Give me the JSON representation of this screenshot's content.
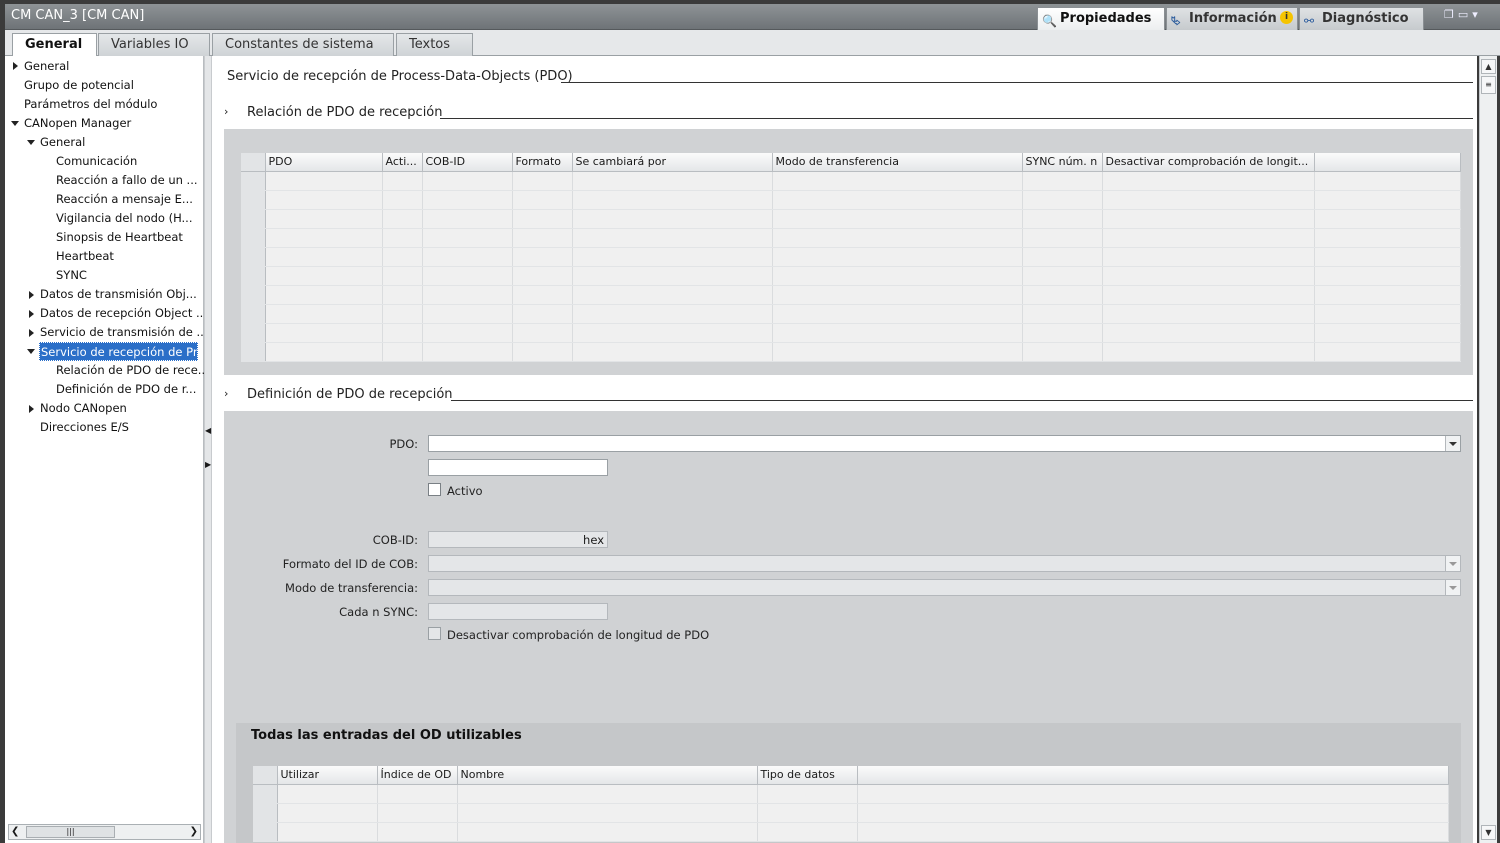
{
  "window": {
    "title": "CM CAN_3 [CM CAN]"
  },
  "panel_tabs": [
    {
      "label": "Propiedades",
      "icon": "properties-icon"
    },
    {
      "label": "Información",
      "icon": "info-icon"
    },
    {
      "label": "Diagnóstico",
      "icon": "diagnostics-icon"
    }
  ],
  "main_tabs": [
    "General",
    "Variables IO",
    "Constantes de sistema",
    "Textos"
  ],
  "tree": [
    "General",
    "Grupo de potencial",
    "Parámetros del módulo",
    "CANopen Manager",
    "General",
    "Comunicación",
    "Reacción a fallo de un ...",
    "Reacción a mensaje E...",
    "Vigilancia del nodo (H...",
    "Sinopsis de Heartbeat",
    "Heartbeat",
    "SYNC",
    "Datos de transmisión Obj...",
    "Datos de recepción Object ...",
    "Servicio de transmisión de ...",
    "Servicio de recepción de Pr...",
    "Relación de PDO de rece...",
    "Definición de PDO de r...",
    "Nodo CANopen",
    "Direcciones E/S"
  ],
  "content": {
    "section_title": "Servicio de recepción de Process-Data-Objects (PDO)",
    "relation": {
      "title": "Relación de PDO de recepción",
      "columns": [
        "PDO",
        "Acti...",
        "COB-ID",
        "Formato",
        "Se cambiará por",
        "Modo de transferencia",
        "SYNC núm. n",
        "Desactivar comprobación de longit..."
      ]
    },
    "definition": {
      "title": "Definición de PDO de recepción",
      "pdo_label": "PDO:",
      "activo_label": "Activo",
      "cobid_label": "COB-ID:",
      "cobid_suffix": "hex",
      "format_label": "Formato del ID de COB:",
      "transfer_label": "Modo de transferencia:",
      "sync_label": "Cada n SYNC:",
      "disable_check_label": "Desactivar comprobación de longitud de PDO"
    },
    "od": {
      "title": "Todas las entradas del OD utilizables",
      "columns": [
        "Utilizar",
        "Índice de OD",
        "Nombre",
        "Tipo de datos"
      ]
    }
  }
}
